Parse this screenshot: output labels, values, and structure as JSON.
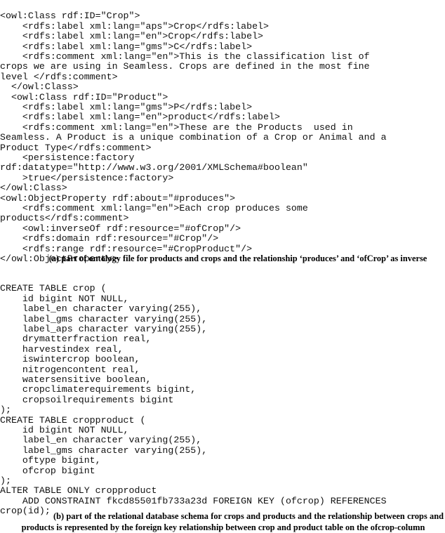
{
  "figure": {
    "background_color": "#ffffff",
    "text_color": "#000000"
  },
  "panel_a": {
    "id": "ontology-listing",
    "language": "owl-xml",
    "caption": "(a) part of ontology file for products and crops and the relationship ‘produces’ and ‘ofCrop’ as inverse",
    "lines": [
      "<owl:Class rdf:ID=\"Crop\">",
      "    <rdfs:label xml:lang=\"aps\">Crop</rdfs:label>",
      "    <rdfs:label xml:lang=\"en\">Crop</rdfs:label>",
      "    <rdfs:label xml:lang=\"gms\">C</rdfs:label>",
      "    <rdfs:comment xml:lang=\"en\">This is the classification list of",
      "crops we are using in Seamless. Crops are defined in the most fine",
      "level </rdfs:comment>",
      "  </owl:Class>",
      "  <owl:Class rdf:ID=\"Product\">",
      "    <rdfs:label xml:lang=\"gms\">P</rdfs:label>",
      "    <rdfs:label xml:lang=\"en\">product</rdfs:label>",
      "    <rdfs:comment xml:lang=\"en\">These are the Products  used in",
      "Seamless. A Product is a unique combination of a Crop or Animal and a",
      "Product Type</rdfs:comment>",
      "    <persistence:factory",
      "rdf:datatype=\"http://www.w3.org/2001/XMLSchema#boolean\"",
      "    >true</persistence:factory>",
      "</owl:Class>",
      "<owl:ObjectProperty rdf:about=\"#produces\">",
      "    <rdfs:comment xml:lang=\"en\">Each crop produces some",
      "products</rdfs:comment>",
      "    <owl:inverseOf rdf:resource=\"#ofCrop\"/>",
      "    <rdfs:domain rdf:resource=\"#Crop\"/>",
      "    <rdfs:range rdf:resource=\"#CropProduct\"/>",
      "</owl:ObjectProperty>"
    ]
  },
  "panel_b": {
    "id": "sql-listing",
    "language": "sql",
    "caption": "(b) part of the relational database schema for crops and products and the relationship between crops and products is represented by the foreign key relationship between crop and product table on the ofcrop-column",
    "lines": [
      "CREATE TABLE crop (",
      "    id bigint NOT NULL,",
      "    label_en character varying(255),",
      "    label_gms character varying(255),",
      "    label_aps character varying(255),",
      "    drymatterfraction real,",
      "    harvestindex real,",
      "    iswintercrop boolean,",
      "    nitrogencontent real,",
      "    watersensitive boolean,",
      "    cropclimaterequirements bigint,",
      "    cropsoilrequirements bigint",
      ");",
      "CREATE TABLE cropproduct (",
      "    id bigint NOT NULL,",
      "    label_en character varying(255),",
      "    label_gms character varying(255),",
      "    oftype bigint,",
      "    ofcrop bigint",
      ");",
      "ALTER TABLE ONLY cropproduct",
      "    ADD CONSTRAINT fkcd85501fb733a23d FOREIGN KEY (ofcrop) REFERENCES",
      "crop(id);"
    ]
  }
}
